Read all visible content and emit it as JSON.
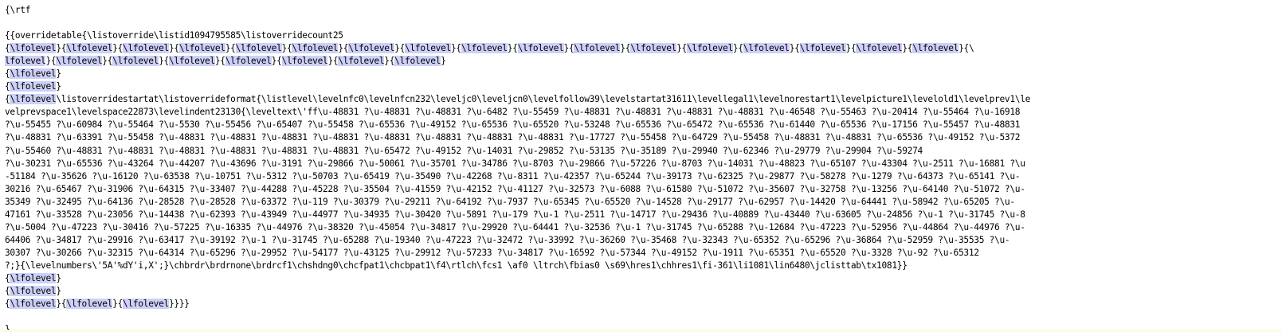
{
  "editor": {
    "highlight_color": "#cdd0f7",
    "highlight_token": "\\lfolevel",
    "lines": [
      "{\\rtf",
      "",
      "{{overridetable{\\listoverride\\listid1094795585\\listoverridecount25",
      "{\\lfolevel}{\\lfolevel}{\\lfolevel}{\\lfolevel}{\\lfolevel}{\\lfolevel}{\\lfolevel}{\\lfolevel}{\\lfolevel}{\\lfolevel}{\\lfolevel}{\\lfolevel}{\\lfolevel}{\\lfolevel}{\\lfolevel}{\\lfolevel}{\\lfolevel}{\\",
      "lfolevel}{\\lfolevel}{\\lfolevel}{\\lfolevel}{\\lfolevel}{\\lfolevel}{\\lfolevel}{\\lfolevel}",
      "{\\lfolevel}",
      "{\\lfolevel}",
      "{\\lfolevel\\listoverridestartat\\listoverrideformat{\\listlevel\\levelnfc0\\levelnfcn232\\leveljc0\\leveljcn0\\levelfollow39\\levelstartat31611\\levellegal1\\levelnorestart1\\levelpicture1\\levelold1\\levelprev1\\le",
      "velprevspace1\\levelspace22873\\levelindent23130{\\leveltext\\'ff\\u-48831 ?\\u-48831 ?\\u-48831 ?\\u-6482 ?\\u-55459 ?\\u-48831 ?\\u-48831 ?\\u-48831 ?\\u-48831 ?\\u-46548 ?\\u-55463 ?\\u-20414 ?\\u-55464 ?\\u-16918",
      "?\\u-55455 ?\\u-60984 ?\\u-55464 ?\\u-5530 ?\\u-55456 ?\\u-65407 ?\\u-55458 ?\\u-65536 ?\\u-49152 ?\\u-65536 ?\\u-65520 ?\\u-53248 ?\\u-65536 ?\\u-65472 ?\\u-65536 ?\\u-61440 ?\\u-65536 ?\\u-17156 ?\\u-55457 ?\\u-48831",
      "?\\u-48831 ?\\u-63391 ?\\u-55458 ?\\u-48831 ?\\u-48831 ?\\u-48831 ?\\u-48831 ?\\u-48831 ?\\u-48831 ?\\u-48831 ?\\u-48831 ?\\u-17727 ?\\u-55458 ?\\u-64729 ?\\u-55458 ?\\u-48831 ?\\u-48831 ?\\u-65536 ?\\u-49152 ?\\u-5372",
      "?\\u-55460 ?\\u-48831 ?\\u-48831 ?\\u-48831 ?\\u-48831 ?\\u-48831 ?\\u-48831 ?\\u-65472 ?\\u-49152 ?\\u-14031 ?\\u-29852 ?\\u-53135 ?\\u-35189 ?\\u-29940 ?\\u-62346 ?\\u-29779 ?\\u-29904 ?\\u-59274",
      "?\\u-30231 ?\\u-65536 ?\\u-43264 ?\\u-44207 ?\\u-43696 ?\\u-3191 ?\\u-29866 ?\\u-50061 ?\\u-35701 ?\\u-34786 ?\\u-8703 ?\\u-29866 ?\\u-57226 ?\\u-8703 ?\\u-14031 ?\\u-48823 ?\\u-65107 ?\\u-43304 ?\\u-2511 ?\\u-16881 ?\\u",
      "-51184 ?\\u-35626 ?\\u-16120 ?\\u-63538 ?\\u-10751 ?\\u-5312 ?\\u-50703 ?\\u-65419 ?\\u-35490 ?\\u-42268 ?\\u-8311 ?\\u-42357 ?\\u-65244 ?\\u-39173 ?\\u-62325 ?\\u-29877 ?\\u-58278 ?\\u-1279 ?\\u-64373 ?\\u-65141 ?\\u-",
      "30216 ?\\u-65467 ?\\u-31906 ?\\u-64315 ?\\u-33407 ?\\u-44288 ?\\u-45228 ?\\u-35504 ?\\u-41559 ?\\u-42152 ?\\u-41127 ?\\u-32573 ?\\u-6088 ?\\u-61580 ?\\u-51072 ?\\u-35607 ?\\u-32758 ?\\u-13256 ?\\u-64140 ?\\u-51072 ?\\u-",
      "35349 ?\\u-32495 ?\\u-64136 ?\\u-28528 ?\\u-28528 ?\\u-63372 ?\\u-119 ?\\u-30379 ?\\u-29211 ?\\u-64192 ?\\u-7937 ?\\u-65345 ?\\u-65520 ?\\u-14528 ?\\u-29177 ?\\u-62957 ?\\u-14420 ?\\u-64441 ?\\u-58942 ?\\u-65205 ?\\u-",
      "47161 ?\\u-33528 ?\\u-23056 ?\\u-14438 ?\\u-62393 ?\\u-43949 ?\\u-44977 ?\\u-34935 ?\\u-30420 ?\\u-5891 ?\\u-179 ?\\u-1 ?\\u-2511 ?\\u-14717 ?\\u-29436 ?\\u-40889 ?\\u-43440 ?\\u-63605 ?\\u-24856 ?\\u-1 ?\\u-31745 ?\\u-8",
      "?\\u-5004 ?\\u-47223 ?\\u-30416 ?\\u-57225 ?\\u-16335 ?\\u-44976 ?\\u-38320 ?\\u-45054 ?\\u-34817 ?\\u-29920 ?\\u-64441 ?\\u-32536 ?\\u-1 ?\\u-31745 ?\\u-65288 ?\\u-12684 ?\\u-47223 ?\\u-52956 ?\\u-44864 ?\\u-44976 ?\\u-",
      "64406 ?\\u-34817 ?\\u-29916 ?\\u-63417 ?\\u-39192 ?\\u-1 ?\\u-31745 ?\\u-65288 ?\\u-19340 ?\\u-47223 ?\\u-32472 ?\\u-33992 ?\\u-36260 ?\\u-35468 ?\\u-32343 ?\\u-65352 ?\\u-65296 ?\\u-36864 ?\\u-52959 ?\\u-35535 ?\\u-",
      "30307 ?\\u-30266 ?\\u-32315 ?\\u-64314 ?\\u-65296 ?\\u-29952 ?\\u-54177 ?\\u-43125 ?\\u-29912 ?\\u-57233 ?\\u-34817 ?\\u-16592 ?\\u-57344 ?\\u-49152 ?\\u-1911 ?\\u-65351 ?\\u-65520 ?\\u-3328 ?\\u-92 ?\\u-65312",
      "?;}{\\levelnumbers\\'5A'%dY'i,X';}\\chbrdr\\brdrnone\\brdrcf1\\chshdng0\\chcfpat1\\chcbpat1\\f4\\rtlch\\fcs1 \\af0 \\ltrch\\fbias0 \\s69\\hres1\\chhres1\\fi-361\\li1081\\lin6480\\jclisttab\\tx1081}}",
      "{\\lfolevel}",
      "{\\lfolevel}",
      "{\\lfolevel}{\\lfolevel}{\\lfolevel}}}}",
      "",
      "}"
    ]
  }
}
